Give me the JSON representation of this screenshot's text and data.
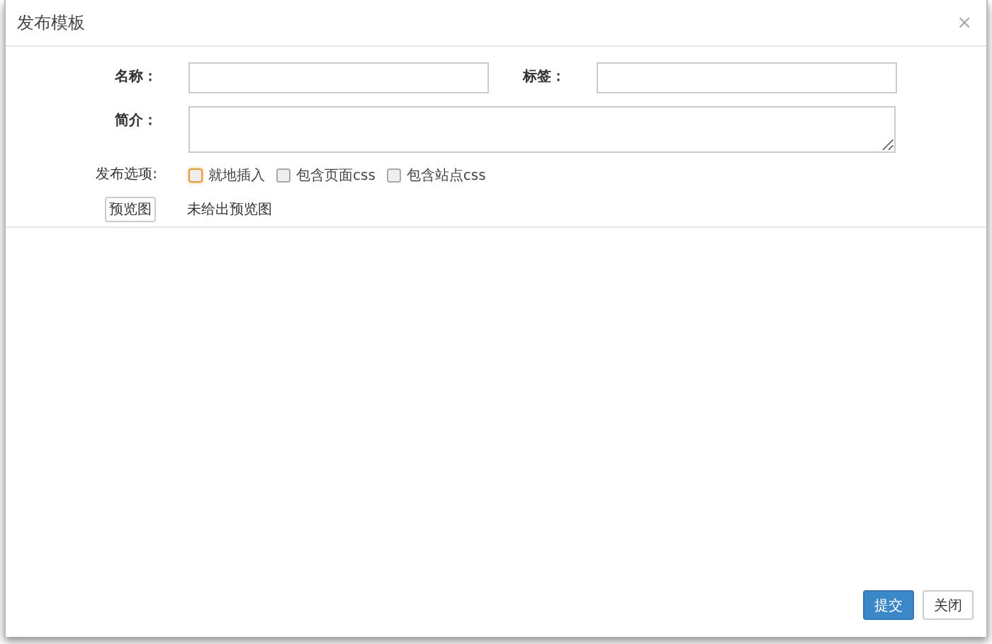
{
  "dialog": {
    "title": "发布模板",
    "close": "×"
  },
  "fields": {
    "name_label": "名称：",
    "tag_label": "标签：",
    "summary_label": "简介："
  },
  "options": {
    "label": "发布选项:",
    "items": [
      {
        "label": "就地插入",
        "checked": false,
        "focused": true
      },
      {
        "label": "包含页面css",
        "checked": false,
        "focused": false
      },
      {
        "label": "包含站点css",
        "checked": false,
        "focused": false
      }
    ]
  },
  "preview": {
    "button": "预览图",
    "status": "未给出预览图"
  },
  "buttons": [
    {
      "label": "提交",
      "kind": "primary"
    },
    {
      "label": "关闭",
      "kind": "default"
    }
  ]
}
